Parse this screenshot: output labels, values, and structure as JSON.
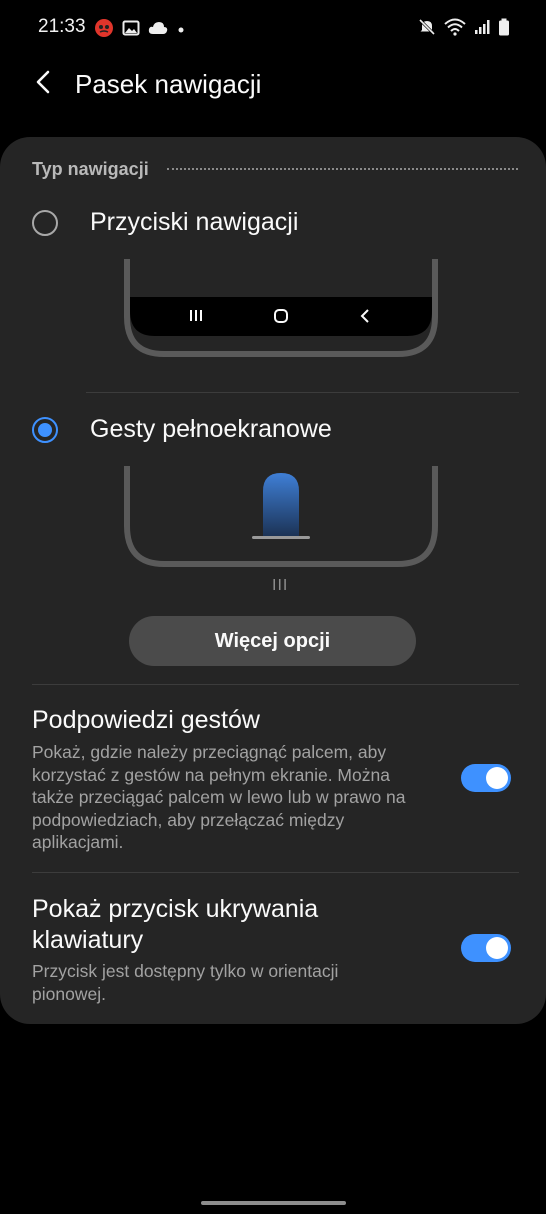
{
  "status_bar": {
    "time": "21:33",
    "left_icons": [
      "notification-badge-icon",
      "image-icon",
      "cloud-icon",
      "dot-icon"
    ],
    "right_icons": [
      "mute-icon",
      "wifi-icon",
      "signal-icon",
      "battery-icon"
    ]
  },
  "header": {
    "title": "Pasek nawigacji",
    "back_icon": "back-arrow-icon"
  },
  "navigation_type": {
    "section_label": "Typ nawigacji",
    "options": [
      {
        "label": "Przyciski nawigacji",
        "selected": false
      },
      {
        "label": "Gesty pełnoekranowe",
        "selected": true
      }
    ],
    "button_icons": [
      "recents-icon",
      "home-icon",
      "back-icon"
    ],
    "gesture_handle_glyph": "III",
    "more_options_label": "Więcej opcji"
  },
  "settings": [
    {
      "title": "Podpowiedzi gestów",
      "description": "Pokaż, gdzie należy przeciągnąć palcem, aby korzystać z gestów na pełnym ekranie. Można także przeciągać palcem w lewo lub w prawo na podpowiedziach, aby przełączać między aplikacjami.",
      "enabled": true
    },
    {
      "title": "Pokaż przycisk ukrywania klawiatury",
      "description": "Przycisk jest dostępny tylko w orientacji pionowej.",
      "enabled": true
    }
  ],
  "colors": {
    "accent": "#3e91ff",
    "card_background": "#252525",
    "page_background": "#000000"
  }
}
